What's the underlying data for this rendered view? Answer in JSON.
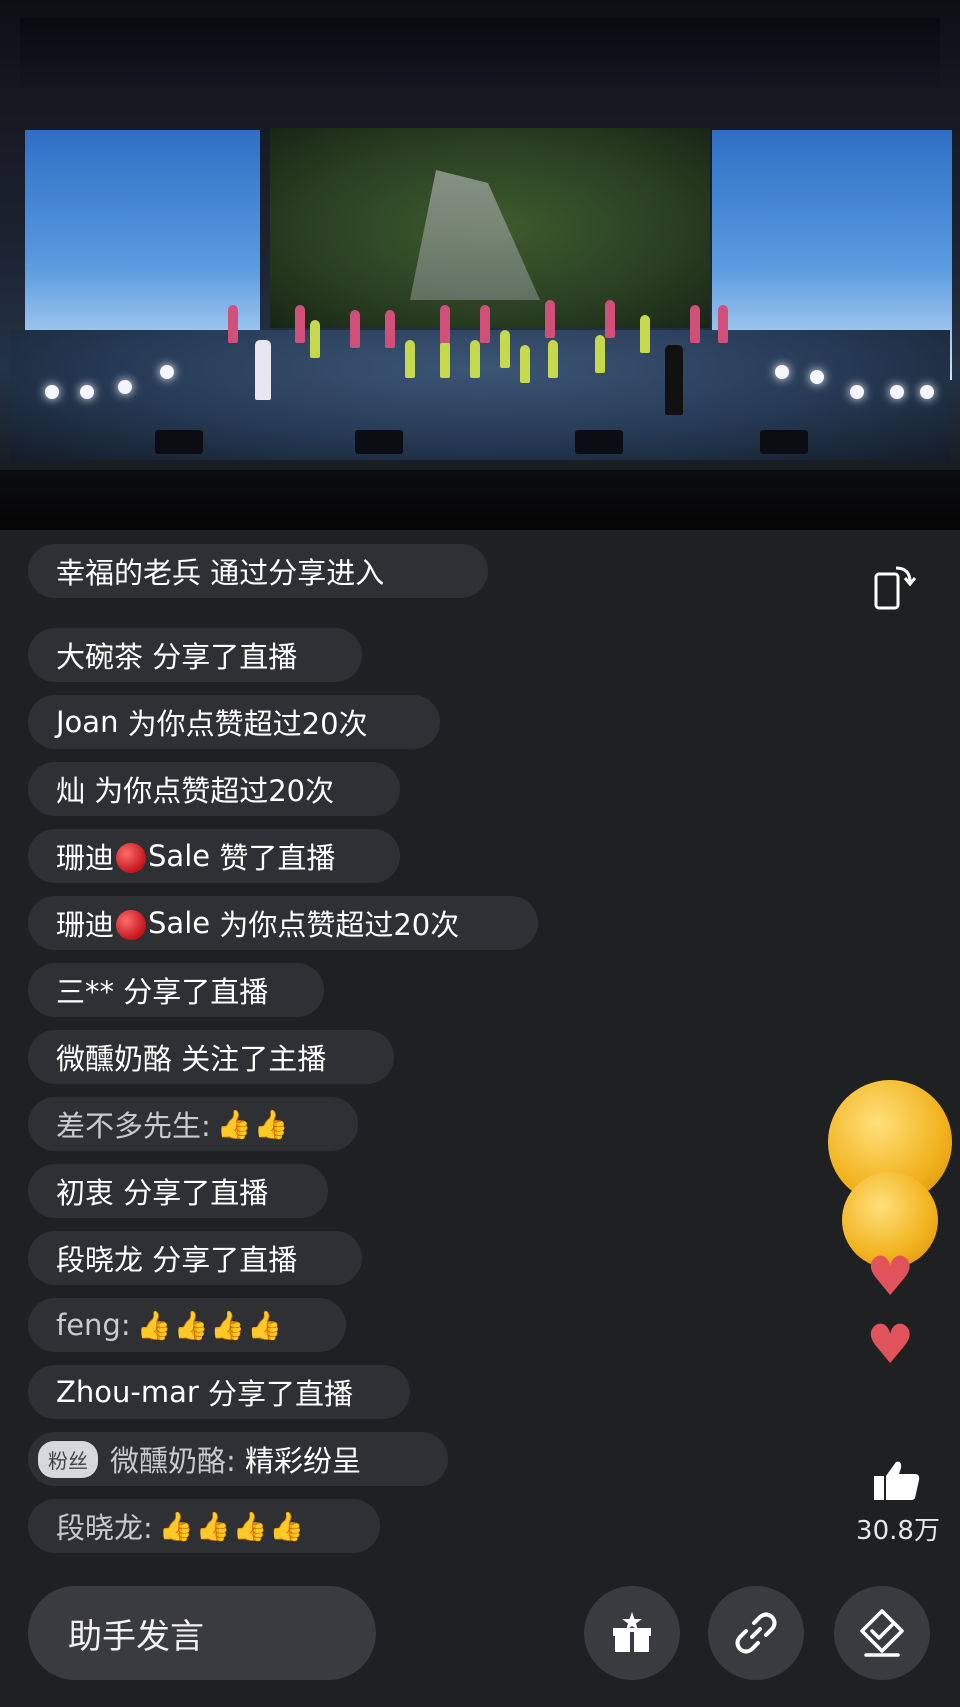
{
  "messages": [
    {
      "prefix": "幸福的老兵",
      "text": "通过分享进入"
    },
    {
      "prefix": "大碗茶",
      "text": "分享了直播"
    },
    {
      "prefix": "Joan",
      "text": "为你点赞超过20次"
    },
    {
      "prefix": "灿",
      "text": "为你点赞超过20次"
    },
    {
      "prefix": "珊迪",
      "suffix": "Sale",
      "text": "赞了直播"
    },
    {
      "prefix": "珊迪",
      "suffix": "Sale",
      "text": "为你点赞超过20次"
    },
    {
      "prefix": "三**",
      "text": "分享了直播"
    },
    {
      "prefix": "微醺奶酪",
      "text": "关注了主播"
    },
    {
      "prefix": "差不多先生:",
      "thumbs": "👍👍"
    },
    {
      "prefix": "初衷",
      "text": "分享了直播"
    },
    {
      "prefix": "段晓龙",
      "text": "分享了直播"
    },
    {
      "prefix": "feng:",
      "thumbs": "👍👍👍👍"
    },
    {
      "prefix": "Zhou-mar",
      "text": "分享了直播"
    },
    {
      "badge": "粉丝",
      "prefix": "微醺奶酪:",
      "text": "精彩纷呈"
    },
    {
      "prefix": "段晓龙:",
      "thumbs": "👍👍👍👍"
    }
  ],
  "like": {
    "count": "30.8万"
  },
  "input": {
    "label": "助手发言"
  },
  "icons": {
    "rotate": "rotate-screen-icon",
    "gift": "gift-box-icon",
    "link": "link-icon",
    "clear": "clear-screen-icon",
    "like": "thumbs-up-icon"
  },
  "colors": {
    "chat_bg": "#3c3e42",
    "heart": "#e0535a",
    "thumb": "#f4c53c",
    "bar_bg": "#3a3b3e"
  }
}
